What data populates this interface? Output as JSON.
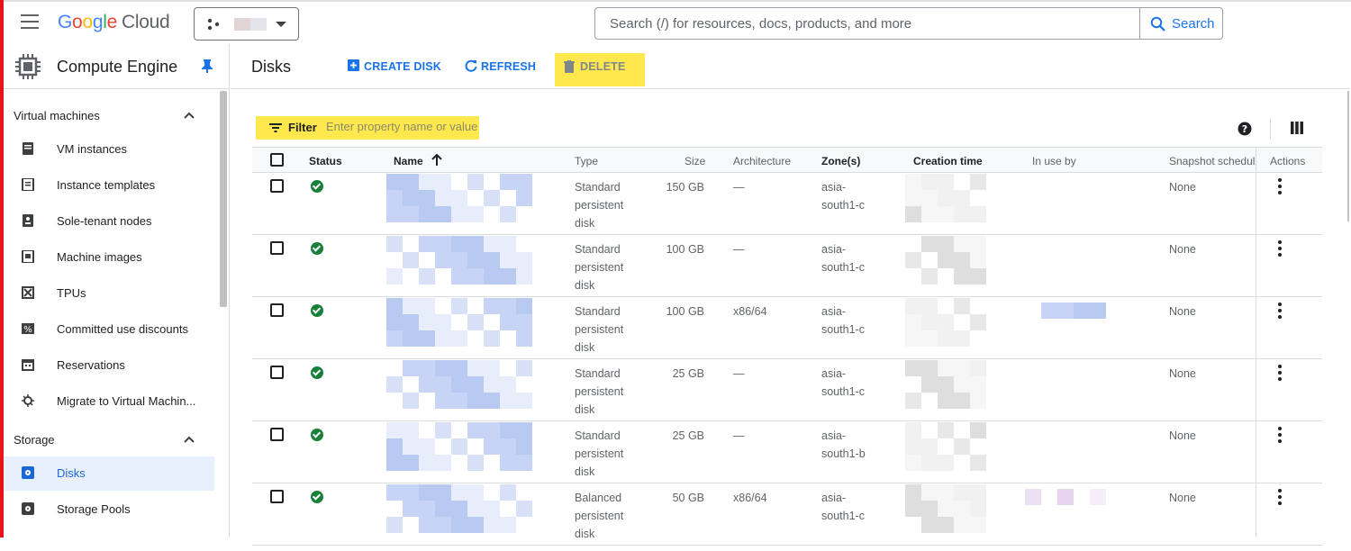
{
  "header": {
    "logo_google": "Google",
    "logo_cloud": "Cloud",
    "search_placeholder": "Search (/) for resources, docs, products, and more",
    "search_button": "Search"
  },
  "sidebar": {
    "product_title": "Compute Engine",
    "sections": [
      {
        "title": "Virtual machines",
        "items": [
          {
            "label": "VM instances",
            "icon": "server-icon"
          },
          {
            "label": "Instance templates",
            "icon": "template-icon"
          },
          {
            "label": "Sole-tenant nodes",
            "icon": "sole-tenant-icon"
          },
          {
            "label": "Machine images",
            "icon": "machine-image-icon"
          },
          {
            "label": "TPUs",
            "icon": "tpu-icon"
          },
          {
            "label": "Committed use discounts",
            "icon": "percent-icon"
          },
          {
            "label": "Reservations",
            "icon": "calendar-icon"
          },
          {
            "label": "Migrate to Virtual Machin...",
            "icon": "migrate-icon"
          }
        ]
      },
      {
        "title": "Storage",
        "items": [
          {
            "label": "Disks",
            "icon": "disk-icon",
            "active": true
          },
          {
            "label": "Storage Pools",
            "icon": "storage-pool-icon"
          }
        ]
      }
    ]
  },
  "toolbar": {
    "page_title": "Disks",
    "create_label": "CREATE DISK",
    "refresh_label": "REFRESH",
    "delete_label": "DELETE"
  },
  "filter": {
    "label": "Filter",
    "placeholder": "Enter property name or value"
  },
  "table": {
    "columns": [
      "Status",
      "Name",
      "Type",
      "Size",
      "Architecture",
      "Zone(s)",
      "Creation time",
      "In use by",
      "Snapshot schedul",
      "Actions"
    ],
    "rows": [
      {
        "type": [
          "Standard",
          "persistent",
          "disk"
        ],
        "size": "150 GB",
        "arch": "—",
        "zone": [
          "asia-",
          "south1-c"
        ],
        "snapshot": "None"
      },
      {
        "type": [
          "Standard",
          "persistent",
          "disk"
        ],
        "size": "100 GB",
        "arch": "—",
        "zone": [
          "asia-",
          "south1-c"
        ],
        "snapshot": "None"
      },
      {
        "type": [
          "Standard",
          "persistent",
          "disk"
        ],
        "size": "100 GB",
        "arch": "x86/64",
        "zone": [
          "asia-",
          "south1-c"
        ],
        "snapshot": "None"
      },
      {
        "type": [
          "Standard",
          "persistent",
          "disk"
        ],
        "size": "25 GB",
        "arch": "—",
        "zone": [
          "asia-",
          "south1-c"
        ],
        "snapshot": "None"
      },
      {
        "type": [
          "Standard",
          "persistent",
          "disk"
        ],
        "size": "25 GB",
        "arch": "—",
        "zone": [
          "asia-",
          "south1-b"
        ],
        "snapshot": "None"
      },
      {
        "type": [
          "Balanced",
          "persistent",
          "disk"
        ],
        "size": "50 GB",
        "arch": "x86/64",
        "zone": [
          "asia-",
          "south1-c"
        ],
        "snapshot": "None"
      }
    ]
  },
  "colors": {
    "accent": "#1a73e8",
    "highlight": "#ffe84d",
    "status_ok": "#188038"
  }
}
